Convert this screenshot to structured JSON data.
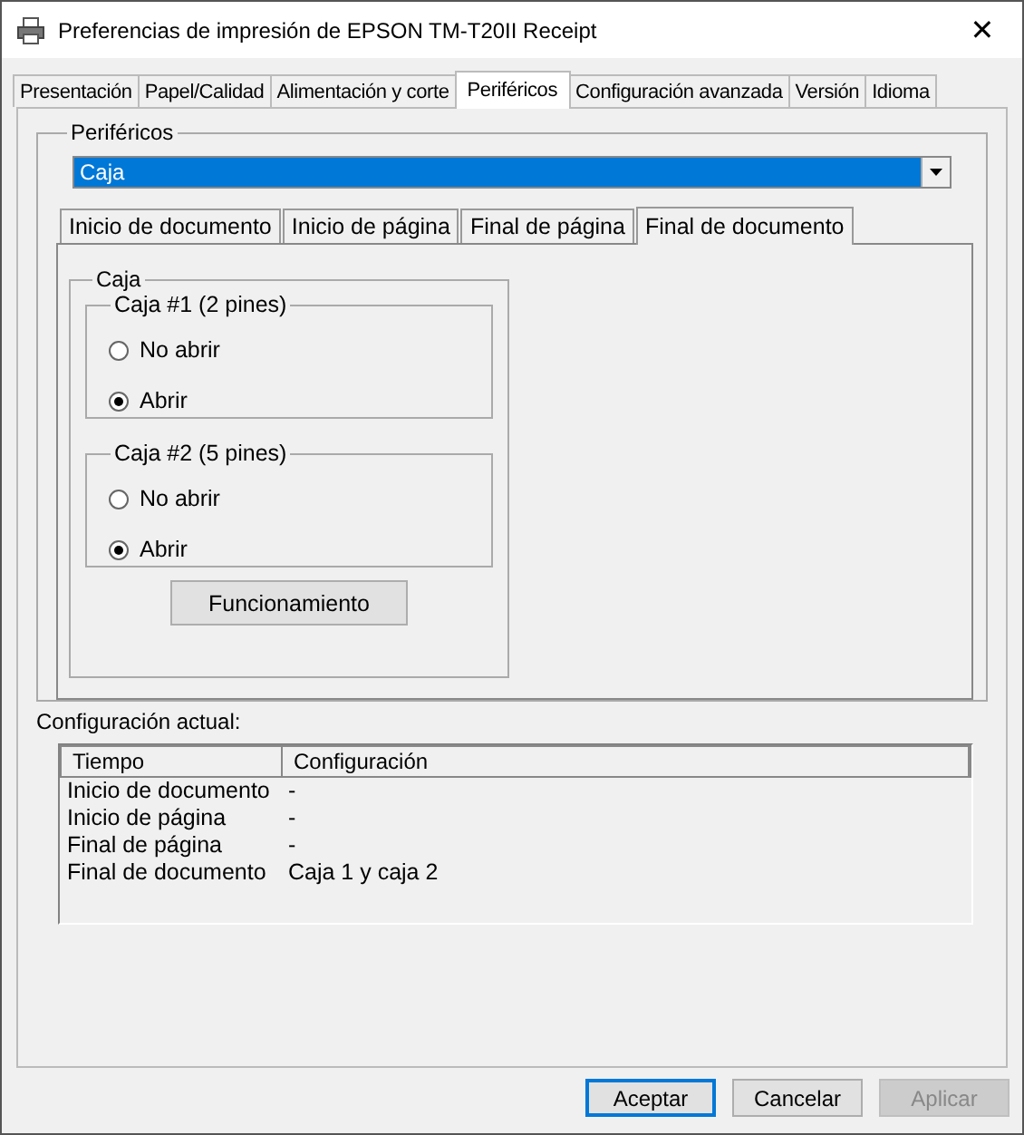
{
  "window": {
    "title": "Preferencias de impresión de EPSON TM-T20II Receipt",
    "close": "✕"
  },
  "tabs": [
    {
      "label": "Presentación",
      "selected": false
    },
    {
      "label": "Papel/Calidad",
      "selected": false
    },
    {
      "label": "Alimentación y corte",
      "selected": false
    },
    {
      "label": "Periféricos",
      "selected": true
    },
    {
      "label": "Configuración avanzada",
      "selected": false
    },
    {
      "label": "Versión",
      "selected": false
    },
    {
      "label": "Idioma",
      "selected": false
    }
  ],
  "peripherals": {
    "legend": "Periféricos",
    "dropdown": {
      "value": "Caja"
    },
    "subtabs": [
      {
        "label": "Inicio de documento",
        "selected": false
      },
      {
        "label": "Inicio de página",
        "selected": false
      },
      {
        "label": "Final de página",
        "selected": false
      },
      {
        "label": "Final de documento",
        "selected": true
      }
    ],
    "group": {
      "legend": "Caja",
      "drawers": [
        {
          "legend": "Caja #1 (2 pines)",
          "options": [
            {
              "label": "No abrir",
              "selected": false
            },
            {
              "label": "Abrir",
              "selected": true
            }
          ]
        },
        {
          "legend": "Caja #2 (5 pines)",
          "options": [
            {
              "label": "No abrir",
              "selected": false
            },
            {
              "label": "Abrir",
              "selected": true
            }
          ]
        }
      ],
      "button": "Funcionamiento"
    }
  },
  "current": {
    "label": "Configuración actual:",
    "columns": [
      "Tiempo",
      "Configuración"
    ],
    "rows": [
      [
        "Inicio de documento",
        "-"
      ],
      [
        "Inicio de página",
        "-"
      ],
      [
        "Final de página",
        "-"
      ],
      [
        "Final de documento",
        "Caja 1 y caja 2"
      ]
    ]
  },
  "buttons": [
    {
      "label": "Aceptar",
      "default": true,
      "disabled": false
    },
    {
      "label": "Cancelar",
      "default": false,
      "disabled": false
    },
    {
      "label": "Aplicar",
      "default": false,
      "disabled": true
    }
  ]
}
